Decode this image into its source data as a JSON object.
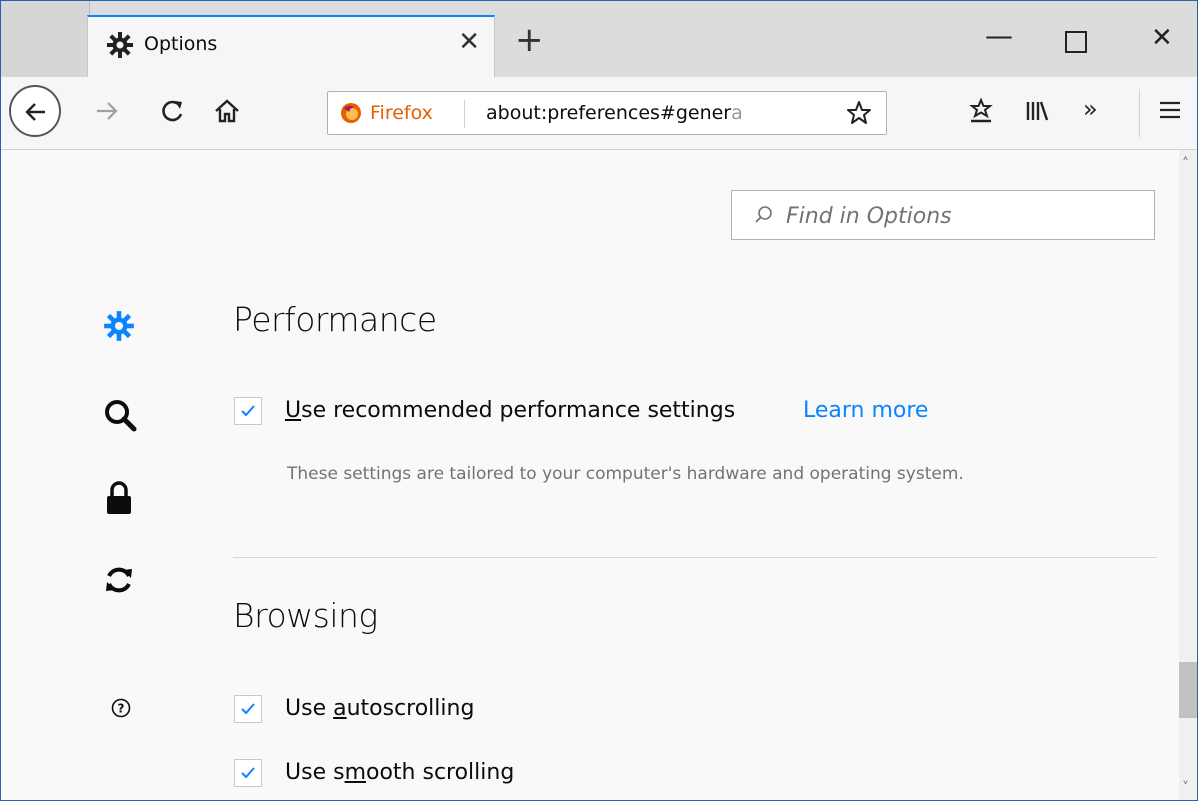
{
  "tab": {
    "title": "Options",
    "icon": "gear-icon"
  },
  "urlbar": {
    "identity": "Firefox",
    "url_main": "about:preferences#gener",
    "url_fade": "a"
  },
  "search": {
    "placeholder": "Find in Options"
  },
  "sidebar": {
    "items": [
      {
        "icon": "gear-icon",
        "name": "general",
        "selected": true
      },
      {
        "icon": "search-icon",
        "name": "search"
      },
      {
        "icon": "lock-icon",
        "name": "privacy"
      },
      {
        "icon": "sync-icon",
        "name": "sync"
      },
      {
        "icon": "help-icon",
        "name": "support"
      }
    ]
  },
  "performance": {
    "title": "Performance",
    "recommended": {
      "pre": "",
      "accesskey": "U",
      "post": "se recommended performance settings",
      "checked": true
    },
    "learn_more": "Learn more",
    "description": "These settings are tailored to your computer's hardware and operating system."
  },
  "browsing": {
    "title": "Browsing",
    "autoscroll": {
      "pre": "Use ",
      "accesskey": "a",
      "post": "utoscrolling",
      "checked": true
    },
    "smooth": {
      "pre": "Use s",
      "accesskey": "m",
      "post": "ooth scrolling",
      "checked": true
    }
  },
  "colors": {
    "accent": "#0a84ff",
    "text": "#0c0c0d",
    "muted": "#737373",
    "firefox_orange": "#e66000"
  }
}
